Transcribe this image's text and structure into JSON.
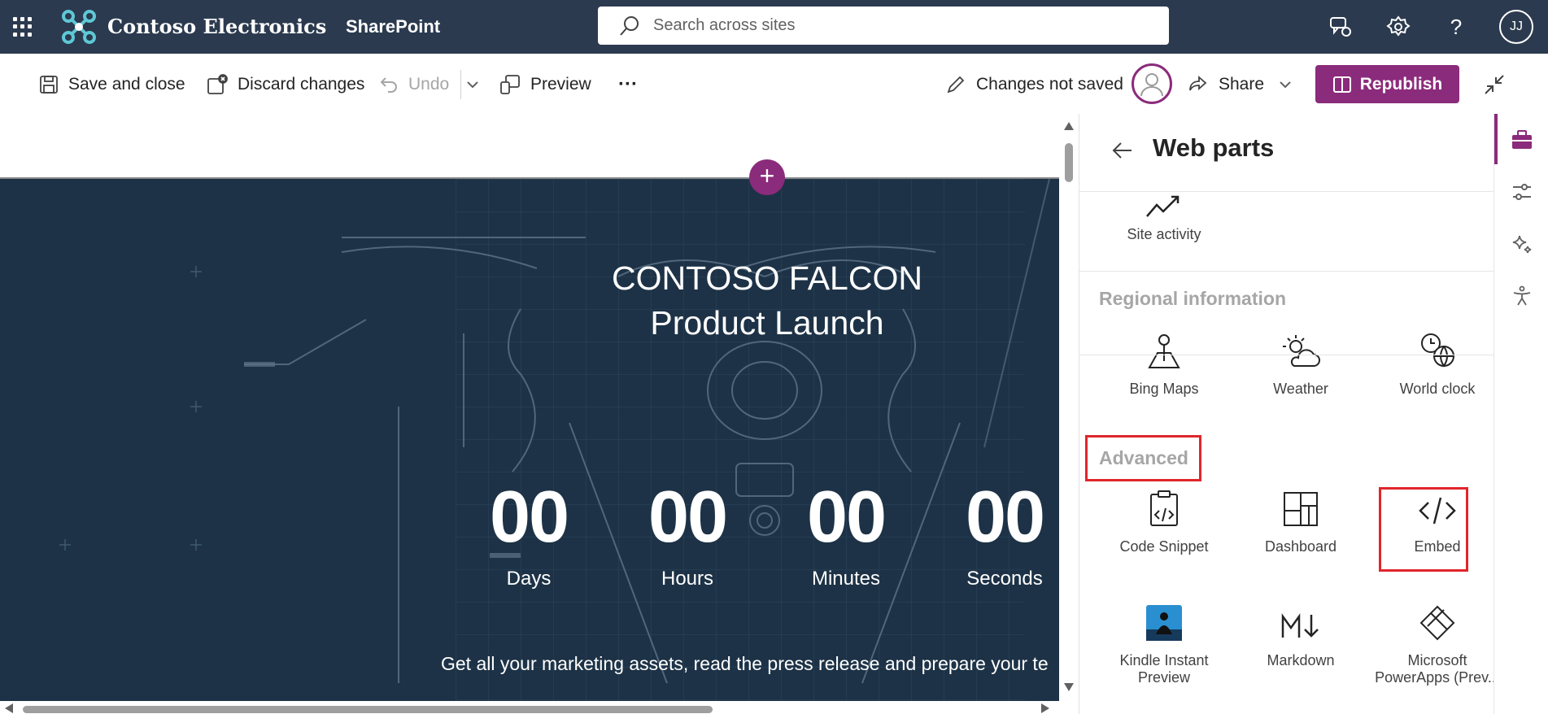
{
  "topbar": {
    "brand_name": "Contoso Electronics",
    "app_name": "SharePoint",
    "search_placeholder": "Search across sites",
    "user_initials": "JJ"
  },
  "commands": {
    "save_close": "Save and close",
    "discard": "Discard changes",
    "undo": "Undo",
    "preview": "Preview",
    "more": "···",
    "status": "Changes not saved",
    "share": "Share",
    "republish": "Republish"
  },
  "hero": {
    "title_line1": "CONTOSO FALCON",
    "title_line2": "Product Launch",
    "countdown": [
      {
        "value": "00",
        "label": "Days"
      },
      {
        "value": "00",
        "label": "Hours"
      },
      {
        "value": "00",
        "label": "Minutes"
      },
      {
        "value": "00",
        "label": "Seconds"
      }
    ],
    "description": "Get all your marketing assets, read the press release and prepare your te"
  },
  "panel": {
    "title": "Web parts",
    "top_item": "Site activity",
    "regional_title": "Regional information",
    "regional": [
      "Bing Maps",
      "Weather",
      "World clock"
    ],
    "advanced_title": "Advanced",
    "advanced": [
      "Code Snippet",
      "Dashboard",
      "Embed"
    ],
    "more_line1": [
      "Kindle Instant",
      "Markdown",
      "Microsoft"
    ],
    "more_line2": [
      "Preview",
      "",
      "PowerApps (Prev..."
    ]
  },
  "colors": {
    "topbar": "#2b3a4f",
    "accent": "#8b2b7b",
    "highlight": "#e0262b",
    "hero_bg": "#1e3347"
  }
}
